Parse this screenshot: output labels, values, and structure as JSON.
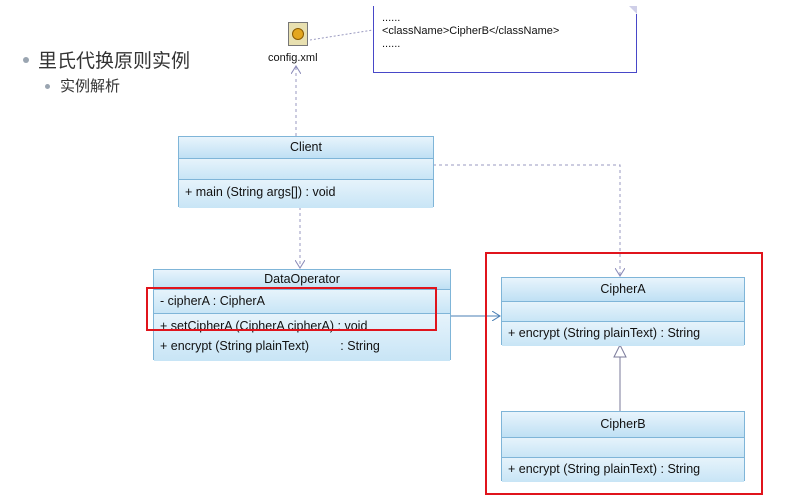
{
  "slide": {
    "heading": "里氏代换原则实例",
    "subheading": "实例解析"
  },
  "config": {
    "icon": "xml-file-icon",
    "label": "config.xml",
    "note_lines": [
      "......",
      "<className>CipherB</className>",
      "......"
    ]
  },
  "classes": {
    "client": {
      "name": "Client",
      "methods": [
        "+ main (String args[]) : void"
      ]
    },
    "data_operator": {
      "name": "DataOperator",
      "attributes": [
        "- cipherA : CipherA"
      ],
      "methods": [
        "+ setCipherA (CipherA cipherA) : void",
        "+ encrypt (String plainText)         : String"
      ]
    },
    "cipher_a": {
      "name": "CipherA",
      "methods": [
        "+ encrypt (String plainText) : String"
      ]
    },
    "cipher_b": {
      "name": "CipherB",
      "methods": [
        "+ encrypt (String plainText) : String"
      ]
    }
  },
  "colors": {
    "highlight": "#e0141c",
    "class_fill": "#cfe8f8",
    "class_border": "#7fb5d8",
    "note_border": "#4848c8"
  }
}
